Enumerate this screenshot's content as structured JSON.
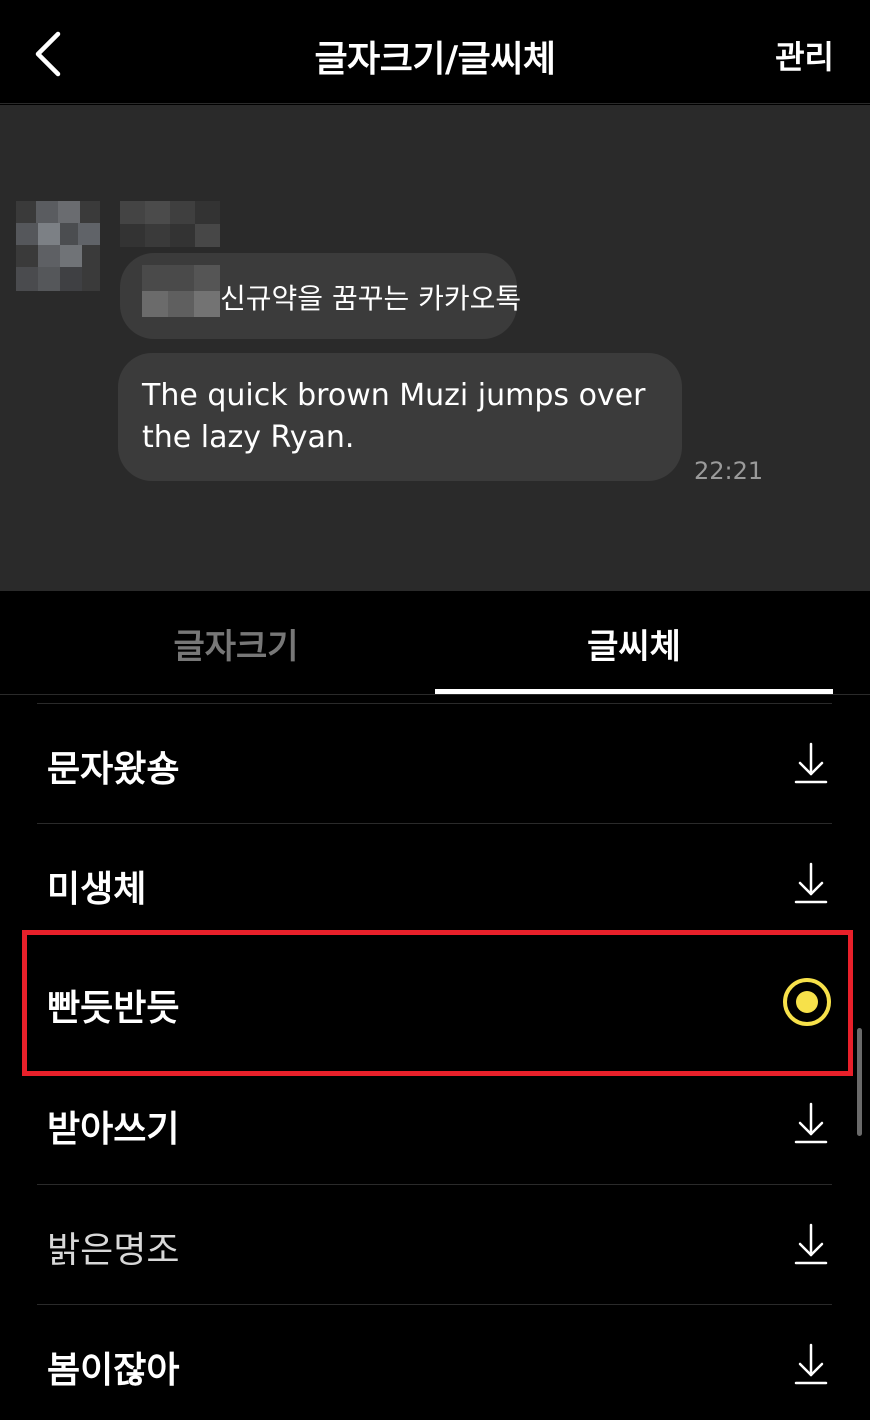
{
  "header": {
    "back_icon": "chevron-left-icon",
    "title": "글자크기/글씨체",
    "manage_label": "관리"
  },
  "preview": {
    "message1": "신규약을 꿈꾸는 카카오톡",
    "message2": "The quick brown Muzi jumps over the lazy Ryan.",
    "time": "22:21"
  },
  "tabs": [
    {
      "label": "글자크기",
      "active": false
    },
    {
      "label": "글씨체",
      "active": true
    }
  ],
  "fonts": [
    {
      "label": "문자왔숑",
      "state": "download",
      "icon": "download-icon"
    },
    {
      "label": "미생체",
      "state": "download",
      "icon": "download-icon"
    },
    {
      "label": "빤듯반듯",
      "state": "selected",
      "icon": "radio-selected-icon"
    },
    {
      "label": "받아쓰기",
      "state": "download",
      "icon": "download-icon"
    },
    {
      "label": "밝은명조",
      "state": "download",
      "icon": "download-icon"
    },
    {
      "label": "봄이잖아",
      "state": "download",
      "icon": "download-icon"
    }
  ],
  "colors": {
    "accent": "#f7e14a",
    "highlight_box": "#e8202a",
    "bubble": "#3b3b3b",
    "preview_bg": "#2a2a2a"
  }
}
